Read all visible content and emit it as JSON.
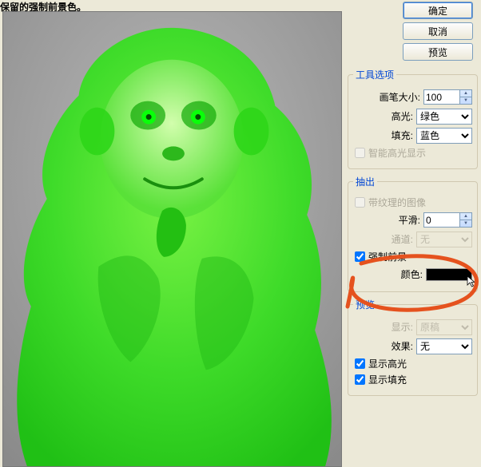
{
  "header": {
    "instruction": "保留的强制前景色。"
  },
  "buttons": {
    "ok": "确定",
    "cancel": "取消",
    "preview": "预览"
  },
  "toolOptions": {
    "legend": "工具选项",
    "brushSizeLabel": "画笔大小:",
    "brushSizeValue": "100",
    "highlightLabel": "高光:",
    "highlightValue": "绿色",
    "fillLabel": "填充:",
    "fillValue": "蓝色",
    "smartHighlightLabel": "智能高光显示"
  },
  "extract": {
    "legend": "抽出",
    "texturedLabel": "带纹理的图像",
    "smoothLabel": "平滑:",
    "smoothValue": "0",
    "channelLabel": "通道:",
    "channelValue": "无",
    "forceFgLabel": "强制前景",
    "colorLabel": "颜色:",
    "colorValue": "#000000"
  },
  "previewSection": {
    "legend": "预览",
    "displayLabel": "显示:",
    "displayValue": "原稿",
    "effectLabel": "效果:",
    "effectValue": "无",
    "showHighlightLabel": "显示高光",
    "showFillLabel": "显示填充"
  }
}
